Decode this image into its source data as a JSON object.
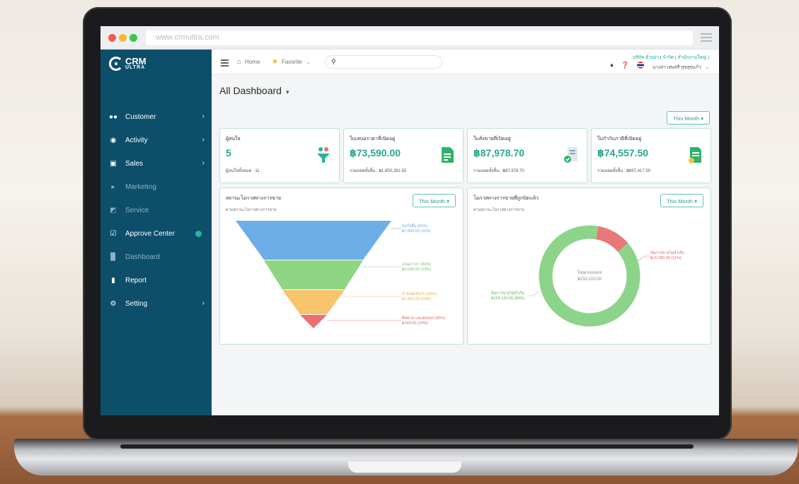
{
  "browser": {
    "url": "www.crmultra.com"
  },
  "logo": {
    "line1": "CRM",
    "line2": "ULTRA"
  },
  "sidebar": {
    "items": [
      {
        "label": "Customer",
        "icon": "users-icon",
        "chevron": true,
        "active": true
      },
      {
        "label": "Activity",
        "icon": "chat-icon",
        "chevron": true,
        "active": true
      },
      {
        "label": "Sales",
        "icon": "cash-icon",
        "chevron": true,
        "active": true
      },
      {
        "label": "Marketing",
        "icon": "megaphone-icon",
        "chevron": false,
        "active": false
      },
      {
        "label": "Service",
        "icon": "headset-icon",
        "chevron": false,
        "active": false
      },
      {
        "label": "Approve Center",
        "icon": "check-square-icon",
        "chevron": false,
        "active": true,
        "badge": true
      },
      {
        "label": "Dashboard",
        "icon": "bar-chart-icon",
        "chevron": false,
        "active": false
      },
      {
        "label": "Report",
        "icon": "document-icon",
        "chevron": false,
        "active": true
      },
      {
        "label": "Setting",
        "icon": "gear-icon",
        "chevron": true,
        "active": true
      }
    ]
  },
  "header": {
    "home_label": "Home",
    "favorite_label": "Favorite",
    "search_placeholder": "",
    "company": "บริษัท ตัวอย่าง จำกัด ( สำนักงานใหญ่ )",
    "user": "นางสาวสมศรี สุขสุขแก้ว"
  },
  "page": {
    "title": "All Dashboard",
    "period": "This Month"
  },
  "stats": [
    {
      "title": "ผู้สนใจ",
      "value": "5",
      "sub": "ผู้สนใจทั้งหมด : 11",
      "icon": "people-funnel-icon",
      "accent": "#29b39b"
    },
    {
      "title": "ใบเสนอราคาที่เปิดอยู่",
      "value": "฿73,590.00",
      "sub": "รวมยอดทั้งสิ้น : ฿1,850,281.55",
      "icon": "quotation-icon",
      "accent": "#27ae60"
    },
    {
      "title": "ใบสั่งขายที่เปิดอยู่",
      "value": "฿87,978.70",
      "sub": "รวมยอดทั้งสิ้น : ฿87,978.70",
      "icon": "sales-order-icon",
      "accent": "#27ae60"
    },
    {
      "title": "ใบกำกับภาษีที่เปิดอยู่",
      "value": "฿74,557.50",
      "sub": "รวมยอดทั้งสิ้น : ฿697,417.50",
      "icon": "invoice-icon",
      "accent": "#27ae60"
    }
  ],
  "funnel_card": {
    "title": "สถานะโอกาสทางการขาย",
    "subtitle": "ตามสถานะโอกาสทางการขาย",
    "period": "This Month",
    "stages": [
      {
        "label": "สนใจซื้อ (60%)",
        "amount": "฿7,800.00 (10%)",
        "color": "#6daee8"
      },
      {
        "label": "เสนอราคา (60%)",
        "amount": "฿4,040.00 (10%)",
        "color": "#8fd684"
      },
      {
        "label": "กำลังตัดสินใจ (50%)",
        "amount": "฿1,800.00 (10%)",
        "color": "#f7c46c"
      },
      {
        "label": "ติดตาม และต่อรอง (30%)",
        "amount": "฿199.00 (10%)",
        "color": "#ea7070"
      }
    ]
  },
  "donut_card": {
    "title": "โอกาสทางการขายที่ถูกปิดแล้ว",
    "subtitle": "ตามสถานะโอกาสทางการขาย",
    "period": "This Month",
    "center_label": "Total Amount",
    "center_value": "฿150,210.00",
    "segments": [
      {
        "label": "ปิดการขายได้สำเร็จ",
        "amount": "฿134,130.00 (89%)",
        "fraction": 0.89,
        "color": "#8cd48a"
      },
      {
        "label": "ปิดการขายไม่สำเร็จ",
        "amount": "฿16,080.00 (11%)",
        "fraction": 0.11,
        "color": "#e97878"
      }
    ]
  }
}
